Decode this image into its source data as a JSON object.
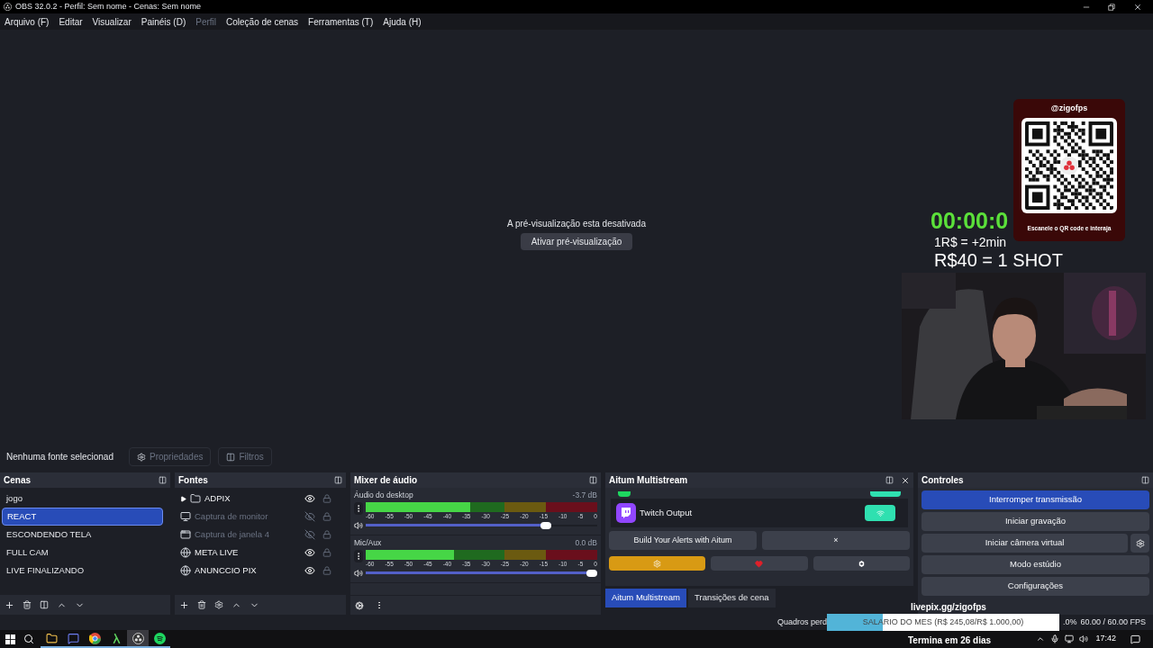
{
  "window": {
    "title": "OBS 32.0.2 - Perfil: Sem nome - Cenas: Sem nome"
  },
  "menu": [
    {
      "label": "Arquivo (F)",
      "disabled": false
    },
    {
      "label": "Editar",
      "disabled": false
    },
    {
      "label": "Visualizar",
      "disabled": false
    },
    {
      "label": "Painéis (D)",
      "disabled": false
    },
    {
      "label": "Perfil",
      "disabled": true
    },
    {
      "label": "Coleção de cenas",
      "disabled": false
    },
    {
      "label": "Ferramentas (T)",
      "disabled": false
    },
    {
      "label": "Ajuda (H)",
      "disabled": false
    }
  ],
  "preview": {
    "message": "A pré-visualização esta desativada",
    "button": "Ativar pré-visualização"
  },
  "source_toolbar": {
    "status": "Nenhuma fonte selecionad",
    "buttons": [
      "Propriedades",
      "Filtros"
    ]
  },
  "scenes": {
    "title": "Cenas",
    "items": [
      {
        "label": "jogo",
        "selected": false
      },
      {
        "label": "REACT",
        "selected": true
      },
      {
        "label": "ESCONDENDO TELA",
        "selected": false
      },
      {
        "label": "FULL CAM",
        "selected": false
      },
      {
        "label": "LIVE FINALIZANDO",
        "selected": false
      }
    ]
  },
  "sources": {
    "title": "Fontes",
    "items": [
      {
        "label": "ADPIX",
        "kind": "folder",
        "visible": true
      },
      {
        "label": "Captura de monitor",
        "kind": "monitor",
        "visible": false
      },
      {
        "label": "Captura de janela 4",
        "kind": "window",
        "visible": false
      },
      {
        "label": "META LIVE",
        "kind": "browser",
        "visible": true
      },
      {
        "label": "ANUNCCIO PIX",
        "kind": "browser",
        "visible": true
      }
    ]
  },
  "mixer": {
    "title": "Mixer de áudio",
    "channels": [
      {
        "name": "Áudio do desktop",
        "reading": "-3.7 dB",
        "meter": {
          "level": 0.45
        },
        "volume": {
          "level": 0.8
        },
        "scale": [
          "-60",
          "-55",
          "-50",
          "-45",
          "-40",
          "-35",
          "-30",
          "-25",
          "-20",
          "-15",
          "-10",
          "-5",
          "0"
        ]
      },
      {
        "name": "Mic/Aux",
        "reading": "0.0 dB",
        "meter": {
          "level": 0.38
        },
        "volume": {
          "level": 1
        },
        "scale": [
          "-60",
          "-55",
          "-50",
          "-45",
          "-40",
          "-35",
          "-30",
          "-25",
          "-20",
          "-15",
          "-10",
          "-5",
          "0"
        ]
      }
    ]
  },
  "aitum": {
    "title": "Aitum Multistream",
    "outputs": [
      {
        "label": "Twitch Output",
        "on": true
      }
    ],
    "buttons": [
      "Build Your Alerts with Aitum",
      "×"
    ]
  },
  "dock_tabs": [
    {
      "label": "Aitum Multistream",
      "selected": true
    },
    {
      "label": "Transições de cena",
      "selected": false
    }
  ],
  "controls": {
    "title": "Controles",
    "buttons": [
      {
        "label": "Interromper transmissão",
        "active": true,
        "settings": false
      },
      {
        "label": "Iniciar gravação",
        "active": false,
        "settings": false
      },
      {
        "label": "Iniciar câmera virtual",
        "active": false,
        "settings": true
      },
      {
        "label": "Modo estúdio",
        "active": false,
        "settings": false
      },
      {
        "label": "Configurações",
        "active": false,
        "settings": false
      }
    ]
  },
  "status_bar": {
    "dropped": "Quadros perd",
    "cpu": ".0%",
    "fps": "60.00 / 60.00 FPS"
  },
  "overlay": {
    "timer": "00:00:0",
    "rate": "1R$ = +2min",
    "shot": "R$40 = 1 SHOT",
    "qr": {
      "handle": "@zigofps",
      "caption": "Escanele o QR code e interaja"
    },
    "goal": {
      "url": "livepix.gg/zigofps",
      "label": "SALARIO DO MES (R$ 245,08/R$ 1.000,00)",
      "level": 0.24,
      "ends": "Termina em 26 dias"
    }
  },
  "taskbar": {
    "apps": [
      {
        "kind": "folder",
        "selected": false
      },
      {
        "kind": "chat",
        "selected": false
      },
      {
        "kind": "browser",
        "selected": false
      },
      {
        "kind": "terminal",
        "selected": false
      },
      {
        "kind": "obs",
        "selected": true
      },
      {
        "kind": "music",
        "selected": false
      }
    ],
    "clock": "17:42"
  }
}
